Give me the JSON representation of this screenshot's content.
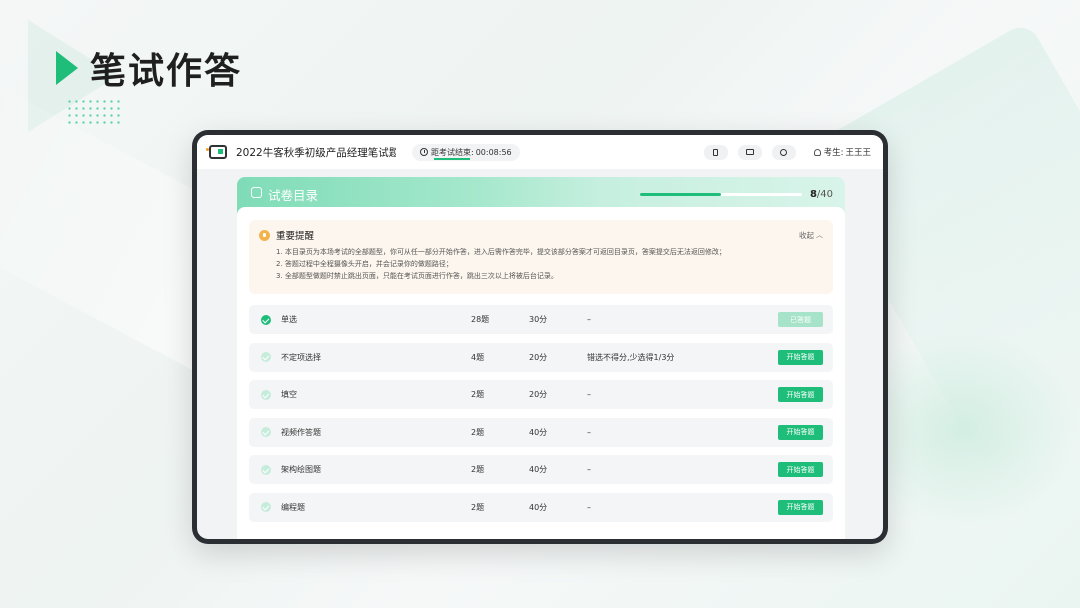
{
  "brand": {
    "title": "笔试作答"
  },
  "app": {
    "exam_title": "2022牛客秋季初级产品经理笔试题...",
    "timer_label": "距考试结束:",
    "timer_value": "00:08:56",
    "tools": [
      "phone-icon",
      "monitor-icon",
      "camera-icon"
    ],
    "candidate_label": "考生:",
    "candidate_name": "王王王"
  },
  "catalog": {
    "title": "试卷目录",
    "progress_done": "8",
    "progress_total": "/40",
    "progress_fraction": 0.5
  },
  "notice": {
    "title": "重要提醒",
    "collapse_label": "收起",
    "lines": [
      "1. 本目录页为本场考试的全部题型，你可从任一部分开始作答，进入后需作答完毕，提交该部分答案才可返回目录页，答案提交后无法返回修改；",
      "2. 答题过程中全程摄像头开启，并会记录你的做题路径；",
      "3. 全部题型做题时禁止跳出页面，只能在考试页面进行作答，跳出三次以上将被后台记录。"
    ]
  },
  "sections": [
    {
      "name": "单选",
      "count": "28题",
      "score": "30分",
      "rule": "–",
      "action": "已答题",
      "answered": true
    },
    {
      "name": "不定项选择",
      "count": "4题",
      "score": "20分",
      "rule": "错选不得分,少选得1/3分",
      "action": "开始答题",
      "answered": false
    },
    {
      "name": "填空",
      "count": "2题",
      "score": "20分",
      "rule": "–",
      "action": "开始答题",
      "answered": false
    },
    {
      "name": "视频作答题",
      "count": "2题",
      "score": "40分",
      "rule": "–",
      "action": "开始答题",
      "answered": false
    },
    {
      "name": "架构绘图题",
      "count": "2题",
      "score": "40分",
      "rule": "–",
      "action": "开始答题",
      "answered": false
    },
    {
      "name": "编程题",
      "count": "2题",
      "score": "40分",
      "rule": "–",
      "action": "开始答题",
      "answered": false
    }
  ],
  "colors": {
    "accent": "#1ebd7a",
    "accent_light": "#a7e3c9",
    "notice_bg": "#fdf6ee"
  }
}
